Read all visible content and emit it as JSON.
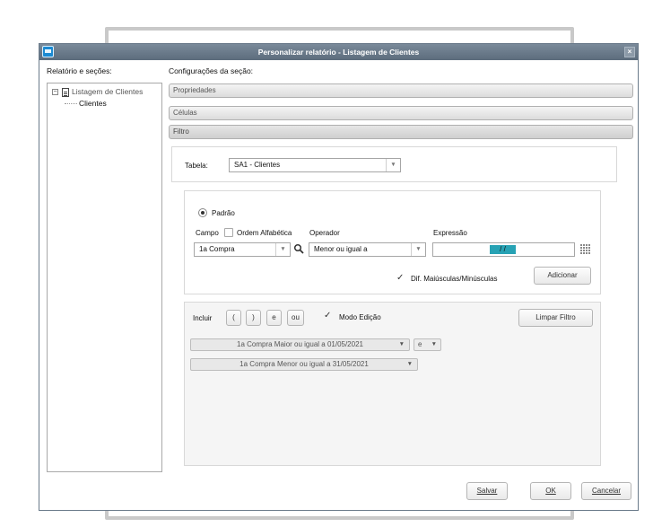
{
  "window": {
    "title": "Personalizar relatório - Listagem de Clientes",
    "close": "×"
  },
  "left": {
    "heading": "Relatório e seções:",
    "tree": {
      "root_label": "Listagem de Clientes",
      "child_label": "Clientes",
      "expander": "−"
    }
  },
  "right": {
    "heading": "Configurações da seção:",
    "sections": [
      "Propriedades",
      "Células",
      "Filtro"
    ]
  },
  "filtro": {
    "tabela_label": "Tabela:",
    "tabela_value": "SA1 - Clientes",
    "modo_label": "Padrão",
    "campo_label": "Campo",
    "ordem_label": "Ordem Alfabética",
    "operador_label": "Operador",
    "expressao_label": "Expressão",
    "campo_value": "1a Compra",
    "operador_value": "Menor ou igual a",
    "expressao_value": "/ /",
    "dif_label": "Dif. Maiúsculas/Minúsculas",
    "adicionar_label": "Adicionar",
    "incluir_label": "Incluir",
    "btn_open_paren": "(",
    "btn_close_paren": ")",
    "btn_e": "e",
    "btn_ou": "ou",
    "modo_edicao_label": "Modo Edição",
    "limpar_label": "Limpar Filtro",
    "filters": [
      {
        "text": "1a Compra Maior ou igual a 01/05/2021",
        "connector": "e"
      },
      {
        "text": "1a Compra Menor ou igual a 31/05/2021"
      }
    ]
  },
  "footer": {
    "salvar": "Salvar",
    "ok": "OK",
    "cancelar": "Cancelar"
  },
  "icons": {
    "dropdown": "▼",
    "check": "✓",
    "search": "search-icon",
    "calendar": "calendar-icon"
  },
  "colors": {
    "titlebar": "#5c6c7c",
    "date_highlight": "#27a2b4"
  }
}
